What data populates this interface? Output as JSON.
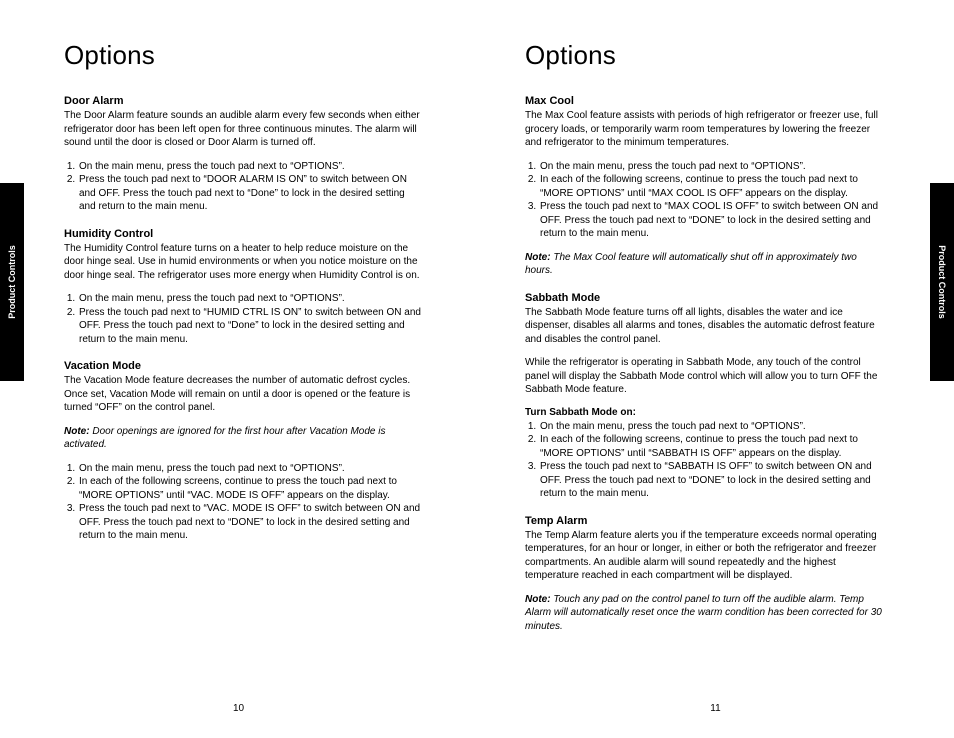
{
  "tabs": {
    "left": "Product Controls",
    "right": "Product Controls"
  },
  "left": {
    "title": "Options",
    "pageNum": "10",
    "sections": [
      {
        "heading": "Door Alarm",
        "body": "The Door Alarm feature sounds an audible alarm every few seconds when either refrigerator door has been left open for three continuous minutes. The alarm will sound until the door is closed or Door Alarm is turned off.",
        "steps": [
          "On the main menu, press the touch pad next to “OPTIONS”.",
          "Press the touch pad next to “DOOR ALARM IS ON” to switch between ON and OFF. Press the touch pad next to “Done” to lock in the desired setting and return to the main menu."
        ]
      },
      {
        "heading": "Humidity Control",
        "body": "The Humidity Control feature turns on a heater to help reduce moisture on the door hinge seal. Use in humid environments or when you notice moisture on the door hinge seal. The refrigerator uses more energy when Humidity Control is on.",
        "steps": [
          "On the main menu, press the touch pad next to “OPTIONS”.",
          "Press the touch pad next to “HUMID CTRL IS ON” to switch between ON and OFF. Press the touch pad next to “Done” to lock in the desired setting and return to the main menu."
        ]
      },
      {
        "heading": "Vacation Mode",
        "body": "The Vacation Mode feature decreases the number of automatic defrost cycles. Once set, Vacation Mode will remain on until a door is opened or the feature is turned “OFF” on the control panel.",
        "noteLabel": "Note:",
        "note": "Door openings are ignored for the first hour after Vacation Mode is activated.",
        "steps": [
          "On the main menu, press the touch pad next to “OPTIONS”.",
          "In each of the following screens, continue to press the touch pad next to “MORE OPTIONS” until “VAC. MODE IS OFF” appears on the display.",
          "Press the touch pad next to “VAC. MODE IS OFF” to switch between ON and OFF. Press the touch pad next to “DONE” to lock in the desired setting and return to the main menu."
        ]
      }
    ]
  },
  "right": {
    "title": "Options",
    "pageNum": "11",
    "sections": [
      {
        "heading": "Max Cool",
        "body": "The Max Cool feature assists with periods of high refrigerator or freezer use, full grocery loads, or temporarily warm room temperatures by lowering the freezer and refrigerator to the minimum temperatures.",
        "steps": [
          "On the main menu, press the touch pad next to “OPTIONS”.",
          "In each of the following screens, continue to press the touch pad next to “MORE OPTIONS” until “MAX COOL IS OFF” appears on the display.",
          "Press the touch pad next to “MAX COOL IS OFF” to switch between ON and OFF. Press the touch pad next to “DONE” to lock in the desired setting and return to the main menu."
        ],
        "noteLabel": "Note:",
        "noteAfter": "The Max Cool feature will automatically shut off in approximately two hours."
      },
      {
        "heading": "Sabbath Mode",
        "body": "The Sabbath Mode feature turns off all lights, disables the water and ice dispenser, disables all alarms and tones, disables the automatic defrost feature and disables the control panel.",
        "body2": "While the refrigerator is operating in Sabbath Mode, any touch of the control panel will display the Sabbath Mode control which will allow you to turn OFF the Sabbath Mode feature.",
        "subhead": "Turn Sabbath Mode on:",
        "steps": [
          "On the main menu, press the touch pad next to “OPTIONS”.",
          "In each of the following screens, continue to press the touch pad next to “MORE OPTIONS” until “SABBATH IS OFF” appears on the display.",
          "Press the touch pad next to “SABBATH IS OFF” to switch between ON and OFF. Press the touch pad next to “DONE” to lock in the desired setting and return to the main menu."
        ]
      },
      {
        "heading": "Temp Alarm",
        "body": "The Temp Alarm feature alerts you if the temperature exceeds normal operating temperatures, for an hour or longer, in either or both the refrigerator and freezer compartments. An audible alarm will sound repeatedly and the highest temperature reached in each compartment will be displayed.",
        "noteLabel": "Note:",
        "noteAfter": "Touch any pad on the control panel to turn off the audible alarm. Temp Alarm will automatically reset once the warm condition has been corrected for 30 minutes."
      }
    ]
  }
}
